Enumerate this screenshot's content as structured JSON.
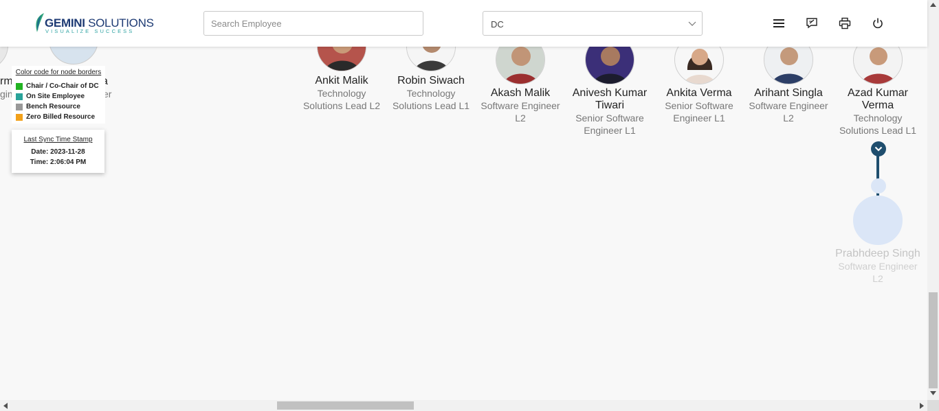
{
  "brand": {
    "name_bold": "GEMINI",
    "name_rest": " SOLUTIONS",
    "tagline": "VISUALIZE SUCCESS"
  },
  "search": {
    "placeholder": "Search Employee"
  },
  "dc_select": {
    "value": "DC"
  },
  "header_icons": [
    "menu-icon",
    "feedback-icon",
    "print-icon",
    "power-icon"
  ],
  "legend": {
    "title": "Color code for node borders",
    "items": [
      {
        "label": "Chair / Co-Chair of DC",
        "color": "#22b322"
      },
      {
        "label": "On Site Employee",
        "color": "#2aa39a"
      },
      {
        "label": "Bench Resource",
        "color": "#999999"
      },
      {
        "label": "Zero Billed Resource",
        "color": "#f2a11a"
      }
    ]
  },
  "sync": {
    "title": "Last Sync Time Stamp",
    "date": "Date: 2023-11-28",
    "time": "Time: 2:06:04 PM"
  },
  "partial_left": {
    "name1": "rma",
    "role1": "gine",
    "name2": "a",
    "role2": "er"
  },
  "nodes": [
    {
      "name": "Ankit Malik",
      "role": "Technology Solutions Lead L2"
    },
    {
      "name": "Robin Siwach",
      "role": "Technology Solutions Lead L1"
    },
    {
      "name": "Akash Malik",
      "role": "Software Engineer L2"
    },
    {
      "name": "Anivesh Kumar Tiwari",
      "role": "Senior Software Engineer L1"
    },
    {
      "name": "Ankita Verma",
      "role": "Senior Software Engineer L1"
    },
    {
      "name": "Arihant Singla",
      "role": "Software Engineer L2"
    },
    {
      "name": "Azad Kumar Verma",
      "role": "Technology Solutions Lead L1"
    }
  ],
  "child_node": {
    "name": "Prabhdeep Singh",
    "role": "Software Engineer L2"
  },
  "colors": {
    "tree_line": "#1f4e6e",
    "child_avatar_bg": "#dbe6f7"
  }
}
